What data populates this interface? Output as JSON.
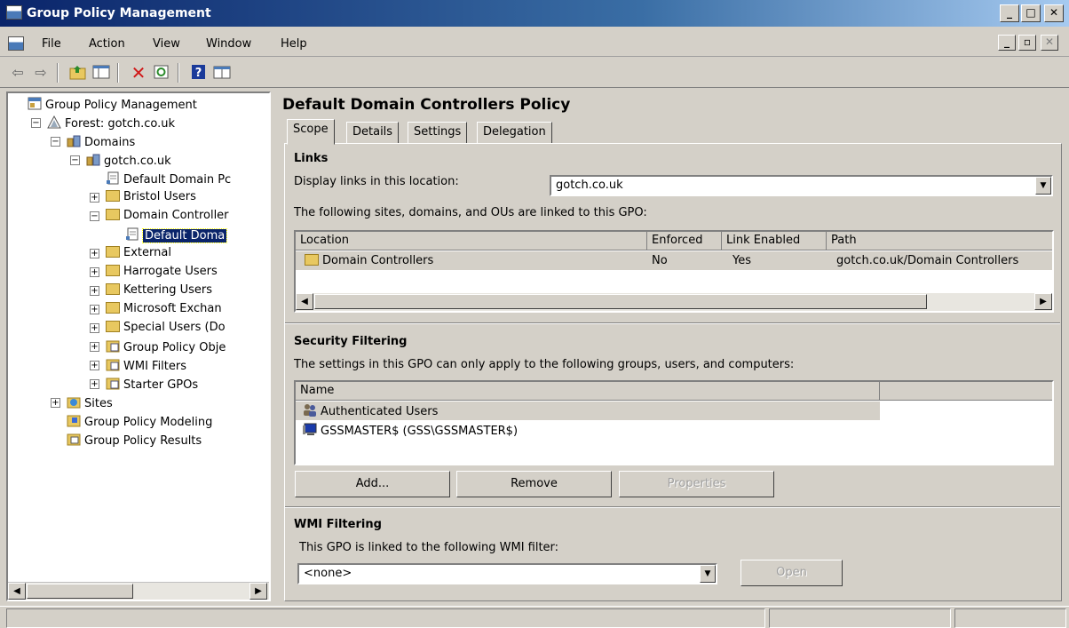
{
  "window": {
    "title": "Group Policy Management",
    "controls": {
      "minimize": "_",
      "maximize": "□",
      "close": "✕"
    }
  },
  "menu": {
    "items": [
      "File",
      "Action",
      "View",
      "Window",
      "Help"
    ],
    "mdi_controls": {
      "minimize": "_",
      "restore": "▫",
      "close": "✕"
    }
  },
  "toolbar": {
    "icons": [
      "back-arrow-icon",
      "forward-arrow-icon",
      "up-folder-icon",
      "show-hide-tree-icon",
      "delete-icon",
      "refresh-icon",
      "help-icon",
      "console-tree-icon"
    ]
  },
  "tree": {
    "items": [
      {
        "label": "Group Policy Management",
        "depth": 0,
        "expander": ""
      },
      {
        "label": "Forest: gotch.co.uk",
        "depth": 1,
        "expander": "−"
      },
      {
        "label": "Domains",
        "depth": 2,
        "expander": "−"
      },
      {
        "label": "gotch.co.uk",
        "depth": 3,
        "expander": "−"
      },
      {
        "label": "Default Domain Pc",
        "depth": 4,
        "expander": ""
      },
      {
        "label": "Bristol Users",
        "depth": 4,
        "expander": "+"
      },
      {
        "label": "Domain Controller",
        "depth": 4,
        "expander": "−"
      },
      {
        "label": "Default Doma",
        "depth": 5,
        "expander": "",
        "selected": true
      },
      {
        "label": "External",
        "depth": 4,
        "expander": "+"
      },
      {
        "label": "Harrogate Users",
        "depth": 4,
        "expander": "+"
      },
      {
        "label": "Kettering Users",
        "depth": 4,
        "expander": "+"
      },
      {
        "label": "Microsoft Exchan",
        "depth": 4,
        "expander": "+"
      },
      {
        "label": "Special Users (Do",
        "depth": 4,
        "expander": "+"
      },
      {
        "label": "Group Policy Obje",
        "depth": 4,
        "expander": "+"
      },
      {
        "label": "WMI Filters",
        "depth": 4,
        "expander": "+"
      },
      {
        "label": "Starter GPOs",
        "depth": 4,
        "expander": "+"
      },
      {
        "label": "Sites",
        "depth": 2,
        "expander": "+"
      },
      {
        "label": "Group Policy Modeling",
        "depth": 2,
        "expander": ""
      },
      {
        "label": "Group Policy Results",
        "depth": 2,
        "expander": ""
      }
    ]
  },
  "main": {
    "title": "Default Domain Controllers Policy",
    "tabs": [
      "Scope",
      "Details",
      "Settings",
      "Delegation"
    ],
    "active_tab": "Scope",
    "links": {
      "heading": "Links",
      "display_label": "Display links in this location:",
      "location_value": "gotch.co.uk",
      "linked_text": "The following sites, domains, and OUs are linked to this GPO:",
      "columns": [
        "Location",
        "Enforced",
        "Link Enabled",
        "Path"
      ],
      "rows": [
        {
          "location": "Domain Controllers",
          "enforced": "No",
          "link_enabled": "Yes",
          "path": "gotch.co.uk/Domain Controllers"
        }
      ]
    },
    "security": {
      "heading": "Security Filtering",
      "description": "The settings in this GPO can only apply to the following groups, users, and computers:",
      "columns": [
        "Name"
      ],
      "rows": [
        "Authenticated Users",
        "GSSMASTER$ (GSS\\GSSMASTER$)"
      ],
      "buttons": {
        "add": "Add...",
        "remove": "Remove",
        "properties": "Properties"
      }
    },
    "wmi": {
      "heading": "WMI Filtering",
      "description": "This GPO is linked to the following WMI filter:",
      "filter_value": "<none>",
      "open_label": "Open"
    }
  },
  "colors": {
    "face": "#d4d0c8",
    "title_start": "#0a246a",
    "title_end": "#a6caf0",
    "selection": "#0a246a"
  }
}
